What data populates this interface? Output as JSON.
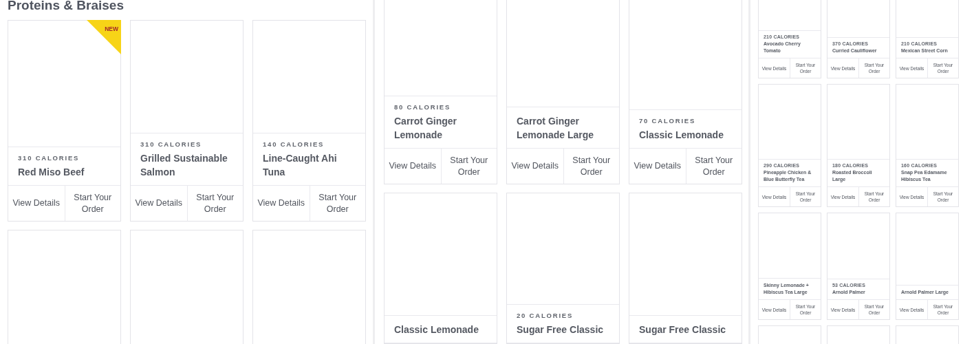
{
  "panels": [
    {
      "heading": "Proteins & Braises",
      "rows": [
        [
          {
            "kind": "product",
            "badge": "NEW",
            "calories": "310 CALORIES",
            "name": "Red Miso Beef",
            "details": "View Details",
            "order": "Start Your Order"
          },
          {
            "kind": "product",
            "calories": "310 CALORIES",
            "name": "Grilled Sustainable Salmon",
            "details": "View Details",
            "order": "Start Your Order"
          },
          {
            "kind": "product",
            "calories": "140 CALORIES",
            "name": "Line-Caught Ahi Tuna",
            "details": "View Details",
            "order": "Start Your Order"
          }
        ],
        [
          {
            "kind": "cut"
          },
          {
            "kind": "cut"
          },
          {
            "kind": "cut"
          }
        ]
      ]
    },
    {
      "rows": [
        [
          {
            "kind": "product",
            "calories": "80 CALORIES",
            "name": "Carrot Ginger Lemonade",
            "details": "View Details",
            "order": "Start Your Order"
          },
          {
            "kind": "product",
            "name": "Carrot Ginger Lemonade Large",
            "details": "View Details",
            "order": "Start Your Order"
          },
          {
            "kind": "product",
            "calories": "70 CALORIES",
            "name": "Classic Lemonade",
            "details": "View Details",
            "order": "Start Your Order"
          }
        ],
        [
          {
            "kind": "product",
            "name": "Classic Lemonade"
          },
          {
            "kind": "product",
            "calories": "20 CALORIES",
            "name": "Sugar Free Classic"
          },
          {
            "kind": "product",
            "name": "Sugar Free Classic"
          }
        ]
      ]
    },
    {
      "rows": [
        [
          {
            "kind": "product",
            "calories": "210 CALORIES",
            "name": "Avocado Cherry Tomato",
            "details": "View Details",
            "order": "Start Your Order"
          },
          {
            "kind": "product",
            "calories": "370 CALORIES",
            "name": "Curried Cauliflower",
            "details": "View Details",
            "order": "Start Your Order"
          },
          {
            "kind": "product",
            "calories": "210 CALORIES",
            "name": "Mexican Street Corn",
            "details": "View Details",
            "order": "Start Your Order"
          }
        ],
        [
          {
            "kind": "product",
            "calories": "290 CALORIES",
            "name": "Pineapple Chicken &",
            "overlap": "Blue Butterfly Tea",
            "details": "View Details",
            "order": "Start Your Order"
          },
          {
            "kind": "product",
            "calories": "180 CALORIES",
            "name": "Roasted Broccoli",
            "overlap": "Large",
            "details": "View Details",
            "order": "Start Your Order"
          },
          {
            "kind": "product",
            "calories": "160 CALORIES",
            "name": "Snap Pea Edamame",
            "overlap": "Hibiscus Tea",
            "details": "View Details",
            "order": "Start Your Order"
          }
        ],
        [
          {
            "kind": "product",
            "name": "Skinny Lemonade + Hibiscus Tea Large",
            "details": "View Details",
            "order": "Start Your Order"
          },
          {
            "kind": "product",
            "calories": "53 CALORIES",
            "name": "Arnold Palmer",
            "details": "View Details",
            "order": "Start Your Order"
          },
          {
            "kind": "product",
            "name": "Arnold Palmer Large",
            "details": "View Details",
            "order": "Start Your Order"
          }
        ],
        [
          {
            "kind": "cut"
          },
          {
            "kind": "cut"
          },
          {
            "kind": "cut"
          }
        ]
      ]
    }
  ]
}
